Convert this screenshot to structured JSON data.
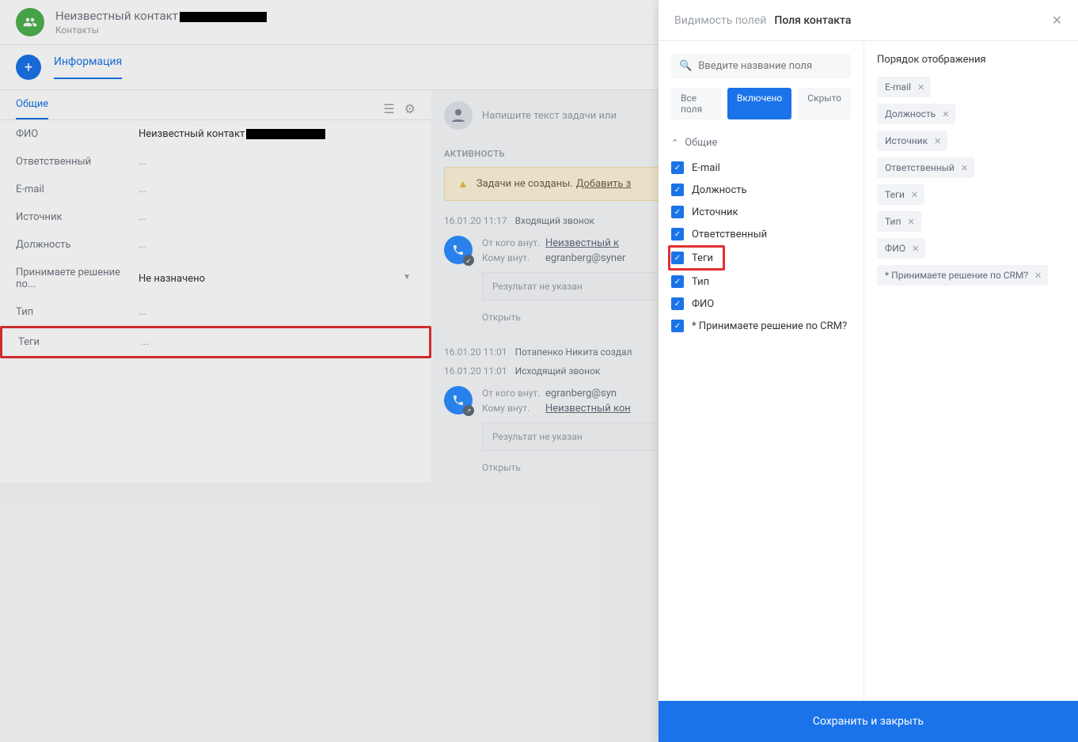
{
  "header": {
    "title_prefix": "Неизвестный контакт",
    "subtitle": "Контакты"
  },
  "toolbar": {
    "tab_info": "Информация"
  },
  "section": {
    "tab_general": "Общие"
  },
  "fields": {
    "fio_label": "ФИО",
    "fio_value": "Неизвестный контакт",
    "resp_label": "Ответственный",
    "email_label": "E-mail",
    "source_label": "Источник",
    "position_label": "Должность",
    "decision_label": "Принимаете решение по...",
    "decision_value": "Не назначено",
    "type_label": "Тип",
    "tags_label": "Теги",
    "ellipsis": "..."
  },
  "activity": {
    "task_placeholder": "Напишите текст задачи или",
    "heading": "АКТИВНОСТЬ",
    "warning_text": "Задачи не созданы.",
    "warning_link": "Добавить з",
    "ts1": "16.01.20 11:17",
    "type_in": "Входящий звонок",
    "from_lbl": "От кого внут.",
    "to_lbl": "Кому внут.",
    "unknown_k": "Неизвестный к",
    "unknown_kon": "Неизвестный кон",
    "egran1": "egranberg@syner",
    "egran2": "egranberg@syn",
    "result": "Результат не указан",
    "open": "Открыть",
    "ts2": "16.01.20 11:01",
    "created": "Потапенко Никита создал",
    "type_out": "Исходящий звонок"
  },
  "drawer": {
    "bc1": "Видимость полей",
    "bc2": "Поля контакта",
    "search_placeholder": "Введите название поля",
    "tab_all": "Все поля",
    "tab_on": "Включено",
    "tab_hidden": "Скрыто",
    "group_general": "Общие",
    "checks": [
      "E-mail",
      "Должность",
      "Источник",
      "Ответственный",
      "Теги",
      "Тип",
      "ФИО",
      "* Принимаете решение по CRM?"
    ],
    "order_title": "Порядок отображения",
    "chips": [
      "E-mail",
      "Должность",
      "Источник",
      "Ответственный",
      "Теги",
      "Тип",
      "ФИО",
      "* Принимаете решение по CRM?"
    ],
    "save_btn": "Сохранить и закрыть"
  }
}
